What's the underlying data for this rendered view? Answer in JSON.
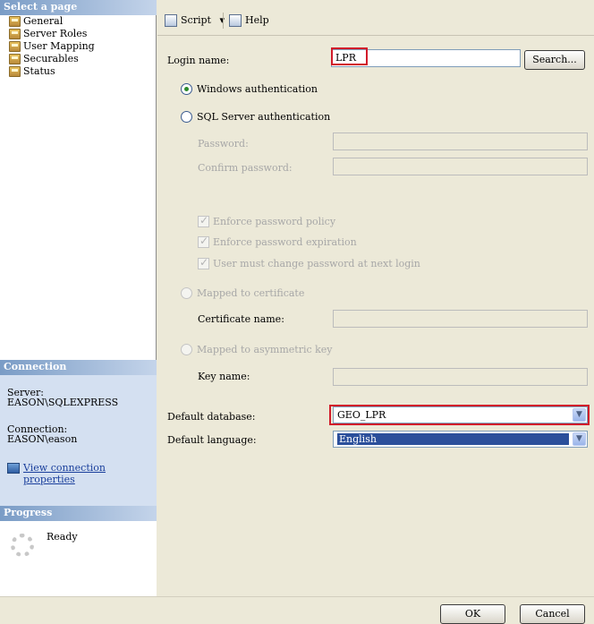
{
  "left": {
    "select_page_header": "Select a page",
    "pages": [
      {
        "label": "General",
        "selected": true
      },
      {
        "label": "Server Roles"
      },
      {
        "label": "User Mapping"
      },
      {
        "label": "Securables"
      },
      {
        "label": "Status"
      }
    ],
    "connection_header": "Connection",
    "server_label": "Server:",
    "server_value": "EASON\\SQLEXPRESS",
    "connection_label": "Connection:",
    "connection_value": "EASON\\eason",
    "view_connection_link": "View connection properties",
    "progress_header": "Progress",
    "progress_status": "Ready"
  },
  "toolbar": {
    "script_label": "Script",
    "script_dropdown": "▾",
    "help_label": "Help"
  },
  "form": {
    "login_name_label": "Login name:",
    "login_name_value": "LPR",
    "search_button": "Search...",
    "windows_auth_label": "Windows authentication",
    "sql_auth_label": "SQL Server authentication",
    "password_label": "Password:",
    "confirm_password_label": "Confirm password:",
    "enforce_policy_label": "Enforce password policy",
    "enforce_expiration_label": "Enforce password expiration",
    "must_change_label": "User must change password at next login",
    "mapped_cert_label": "Mapped to certificate",
    "cert_name_label": "Certificate name:",
    "mapped_asym_label": "Mapped to asymmetric key",
    "key_name_label": "Key name:",
    "default_db_label": "Default database:",
    "default_db_value": "GEO_LPR",
    "default_lang_label": "Default language:",
    "default_lang_value": "English"
  },
  "buttons": {
    "ok": "OK",
    "cancel": "Cancel"
  },
  "colors": {
    "highlight_red": "#d11b2a",
    "selection_blue": "#2b4f9b"
  }
}
